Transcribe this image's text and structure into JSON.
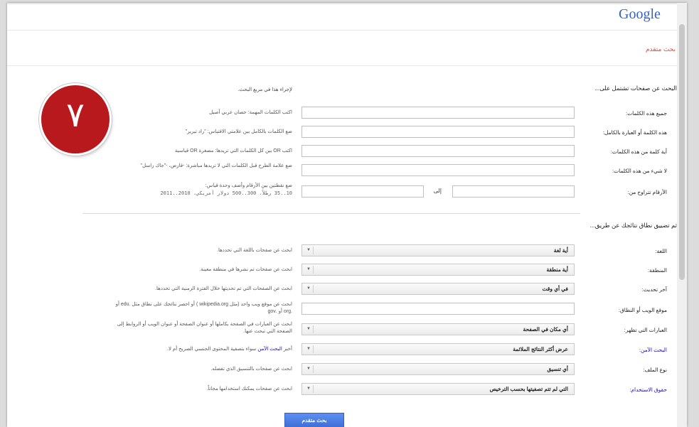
{
  "header": {
    "logo": "Google",
    "title": "بحث متقدم"
  },
  "section1": {
    "title": "البحث عن صفحات تشتمل على...",
    "hint_head": "لإجراء هذا في مربع البحث.",
    "fields": [
      {
        "label": "جميع هذه الكلمات:",
        "hint": "اكتب الكلمات المهمة: حصان عربي أصيل",
        "value": ""
      },
      {
        "label": "هذه الكلمة أو العبارة بالكامل:",
        "hint": "ضع الكلمات بالكامل بين علامتي الاقتباس: \"راد تيرير\"",
        "value": ""
      },
      {
        "label": "أية كلمة من هذه الكلمات:",
        "hint": "اكتب OR بين كل الكلمات التي تريدها: مصغرة OR قياسية",
        "value": ""
      },
      {
        "label": "لا شيء من هذه الكلمات:",
        "hint": "ضع علامة الطرح قبل الكلمات التي لا تريدها مباشرة: -قارض، -\"جاك راسل\"",
        "value": ""
      }
    ],
    "range": {
      "label": "الأرقام تتراوح من:",
      "sep": "إلى",
      "hint_line1": "ضع نقطتين بين الأرقام وأضف وحدة قياس:",
      "hint_line2": "10..35 رطلاً، 300..500 دولار أمريكي، 2010..2011"
    }
  },
  "section2": {
    "title": "ثم تضييق نطاق نتائجك عن طريق...",
    "rows": [
      {
        "label": "اللغة:",
        "value": "أية لغة",
        "hint": "ابحث عن صفحات باللغة التي تحددها."
      },
      {
        "label": "المنطقة:",
        "value": "أية منطقة",
        "hint": "ابحث عن صفحات تم نشرها في منطقة معينة."
      },
      {
        "label": "آخر تحديث:",
        "value": "في أي وقت",
        "hint": "ابحث عن الصفحات التي تم تحديثها خلال الفترة الزمنية التي تحددها."
      },
      {
        "label": "موقع الويب أو النطاق:",
        "value": "",
        "hint": "ابحث عن موقع ويب واحد (مثل wikipedia.org ) أو احصر نتائجك على نطاق مثل .edu أو .org أو .gov"
      },
      {
        "label": "العبارات التي تظهر:",
        "value": "أي مكان في الصفحة",
        "hint": "ابحث عن العبارات في الصفحة بكاملها أو عنوان الصفحة أو عنوان الويب أو الروابط إلى الصفحة التي تبحث عنها."
      },
      {
        "label": "البحث الآمن:",
        "value": "عرض أكثر النتائج الملائمة",
        "hint_prefix": "أخبر ",
        "hint_link": "البحث الآمن",
        "hint_suffix": " سواء بتصفية المحتوى الجنسي الصريح أم لا."
      },
      {
        "label": "نوع الملف:",
        "value": "أي تنسيق",
        "hint": "ابحث عن صفحات بالتنسيق الذي تفضله."
      },
      {
        "label": "حقوق الاستخدام:",
        "value": "التي لم تتم تصفيتها بحسب الترخيص",
        "hint": "ابحث عن صفحات يمكنك استخدامها مجاناً."
      }
    ]
  },
  "submit_label": "بحث متقدم",
  "badge_number": "٧",
  "colors": {
    "accent": "#dd4b39",
    "link": "#1a0dab",
    "button": "#4d7fe8",
    "badge": "#b8191d"
  }
}
